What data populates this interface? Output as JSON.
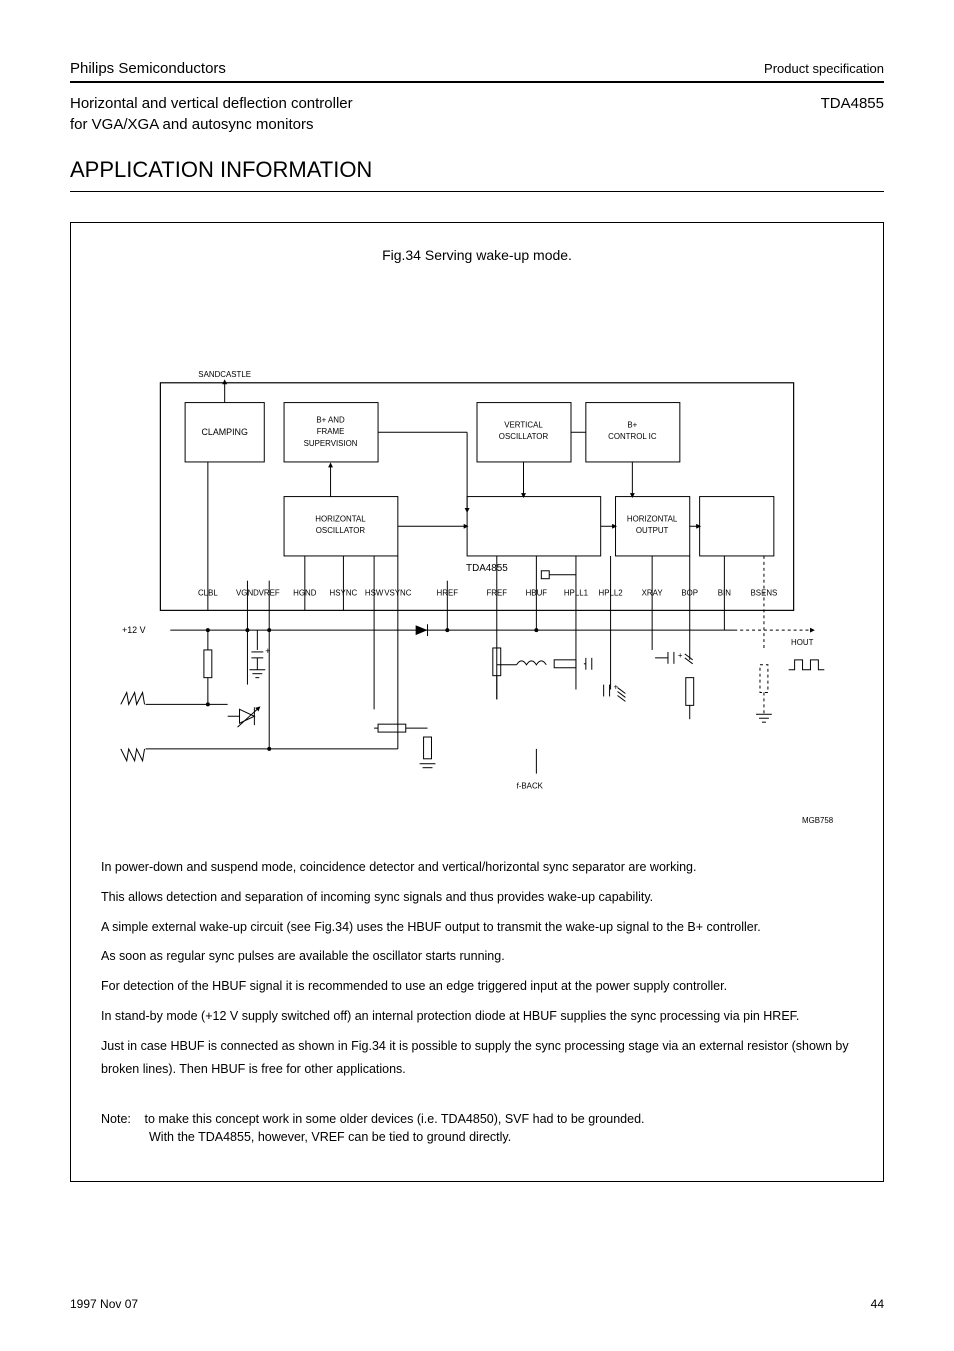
{
  "header": {
    "company": "Philips Semiconductors",
    "doctype": "Product specification",
    "title_left": "Horizontal and vertical deflection controller",
    "title_middle": "for VGA/XGA and autosync monitors",
    "product": "TDA4855"
  },
  "section_title": "APPLICATION INFORMATION",
  "figure": {
    "caption": "Fig.34  Serving wake-up mode."
  },
  "blocks": {
    "clamping": "CLAMPING",
    "b_frame": "B+ AND\nFRAME\nSUPERVISION",
    "vertical_osc": "VERTICAL\nOSCILLATOR",
    "b_control": "B+\nCONTROL IC",
    "tda": "TDA4855",
    "horizontal_osc": "HORIZONTAL\nOSCILLATOR",
    "horizontal_output": "HORIZONTAL\nOUTPUT"
  },
  "pins": {
    "hpll2": "HPLL2",
    "xray": "XRAY",
    "bop": "BOP",
    "bin": "BIN",
    "bsens": "BSENS",
    "hpll1": "HPLL1",
    "href": "HREF",
    "fref": "FREF",
    "hbuf": "HBUF",
    "vref": "VREF",
    "clbl": "CLBL",
    "vgnd": "VGND",
    "hgnd": "HGND",
    "hsync": "HSYNC",
    "vsync": "VSYNC",
    "fback": "f-BACK",
    "hout": "HOUT",
    "p12v": "+12 V",
    "sandcastle": "SANDCASTLE",
    "mgb758": "MGB758",
    "hsw": "HSW"
  },
  "desc": {
    "p1": "In power-down and suspend mode, coincidence detector and vertical/horizontal sync separator are working.",
    "p2": "This allows detection and separation of incoming sync signals and thus provides wake-up capability.",
    "p3": "A simple external wake-up circuit (see Fig.34) uses the HBUF output to transmit the wake-up signal to the B+ controller.",
    "p4": "As soon as regular sync pulses are available the oscillator starts running.",
    "p5": "For detection of the HBUF signal it is recommended to use an edge triggered input at the power supply controller.",
    "p6": "In stand-by mode (+12 V supply switched off) an internal protection diode at HBUF supplies the sync processing via pin HREF.",
    "p7": "Just in case HBUF is connected as shown in Fig.34 it is possible to supply the sync processing stage via an external resistor (shown by broken lines). Then HBUF is free for other applications."
  },
  "note": {
    "label": "Note:",
    "line1": "to make this concept work in some older devices (i.e. TDA4850), SVF had to be grounded.",
    "line2": "With the TDA4855, however, VREF can be tied to ground directly."
  },
  "footer": {
    "date": "1997 Nov 07",
    "page": "44"
  }
}
